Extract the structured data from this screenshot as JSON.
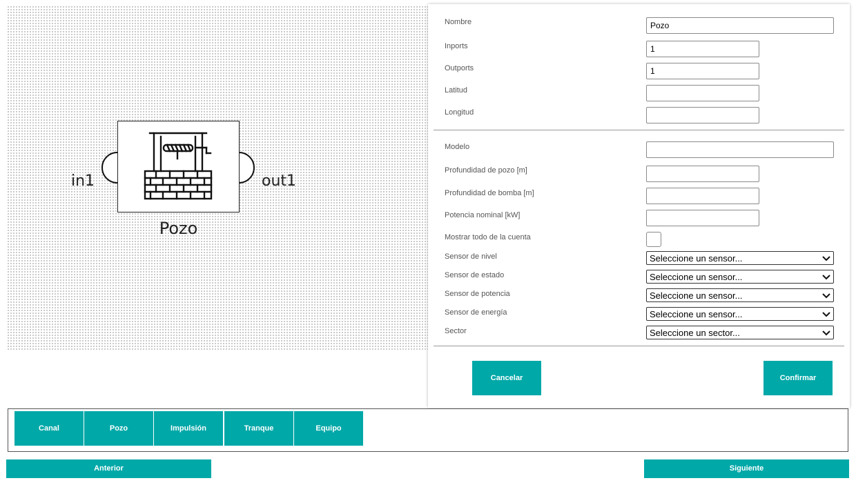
{
  "canvas": {
    "block": {
      "title": "Pozo",
      "in_port": "in1",
      "out_port": "out1",
      "icon": "well-icon"
    }
  },
  "form": {
    "nombre": {
      "label": "Nombre",
      "value": "Pozo"
    },
    "inports": {
      "label": "Inports",
      "value": "1"
    },
    "outports": {
      "label": "Outports",
      "value": "1"
    },
    "latitud": {
      "label": "Latitud",
      "value": ""
    },
    "longitud": {
      "label": "Longitud",
      "value": ""
    },
    "modelo": {
      "label": "Modelo",
      "value": ""
    },
    "prof_pozo": {
      "label": "Profundidad de pozo [m]",
      "value": ""
    },
    "prof_bomba": {
      "label": "Profundidad de bomba [m]",
      "value": ""
    },
    "potencia": {
      "label": "Potencia nominal [kW]",
      "value": ""
    },
    "mostrar": {
      "label": "Mostrar todo de la cuenta",
      "checked": false
    },
    "sensor_nivel": {
      "label": "Sensor de nivel",
      "selected": "Seleccione un sensor..."
    },
    "sensor_estado": {
      "label": "Sensor de estado",
      "selected": "Seleccione un sensor..."
    },
    "sensor_potencia": {
      "label": "Sensor de potencia",
      "selected": "Seleccione un sensor..."
    },
    "sensor_energia": {
      "label": "Sensor de energía",
      "selected": "Seleccione un sensor..."
    },
    "sector": {
      "label": "Sector",
      "selected": "Seleccione un sector..."
    },
    "cancel_label": "Cancelar",
    "confirm_label": "Confirmar"
  },
  "palette": {
    "items": [
      {
        "label": "Canal"
      },
      {
        "label": "Pozo"
      },
      {
        "label": "Impulsión"
      },
      {
        "label": "Tranque"
      },
      {
        "label": "Equipo"
      }
    ]
  },
  "nav": {
    "prev_label": "Anterior",
    "next_label": "Siguiente"
  },
  "colors": {
    "accent": "#00a8a8"
  }
}
